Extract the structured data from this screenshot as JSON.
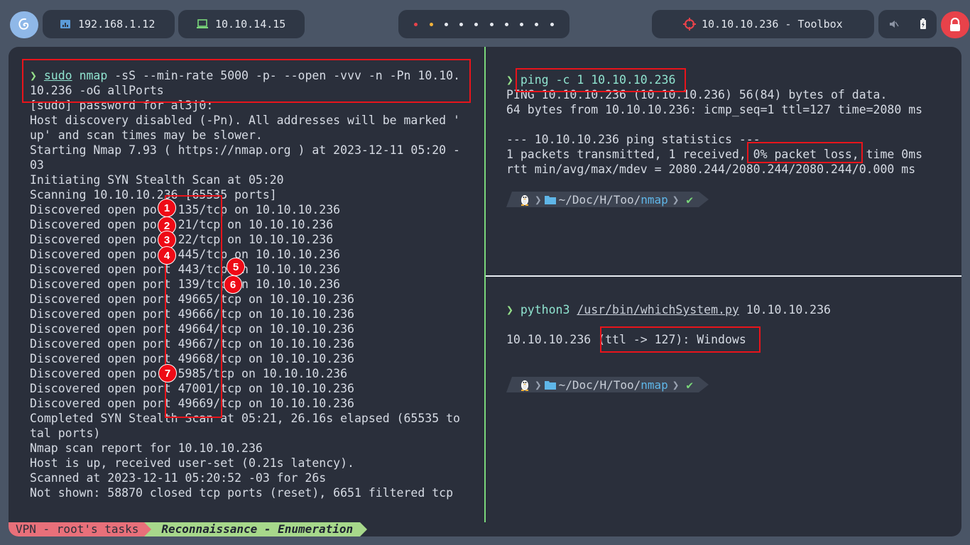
{
  "topbar": {
    "eth_ip": "192.168.1.12",
    "vpn_ip": "10.10.14.15",
    "target": "10.10.10.236 - Toolbox",
    "workspace_count": 10
  },
  "left_pane": {
    "prompt_symbol": "❯",
    "cmd_sudo": "sudo",
    "cmd_nmap": "nmap",
    "cmd_args_1": " -sS --min-rate 5000 -p- --open -vvv -n -Pn 10.10.",
    "cmd_args_2": "10.236 -oG allPorts",
    "lines": [
      "[sudo] password for al3j0:",
      "Host discovery disabled (-Pn). All addresses will be marked '",
      "up' and scan times may be slower.",
      "Starting Nmap 7.93 ( https://nmap.org ) at 2023-12-11 05:20 -",
      "03",
      "Initiating SYN Stealth Scan at 05:20",
      "Scanning 10.10.10.236 [65535 ports]",
      "Discovered open port 135/tcp on 10.10.10.236",
      "Discovered open port 21/tcp on 10.10.10.236",
      "Discovered open port 22/tcp on 10.10.10.236",
      "Discovered open port 445/tcp on 10.10.10.236",
      "Discovered open port 443/tcp on 10.10.10.236",
      "Discovered open port 139/tcp on 10.10.10.236",
      "Discovered open port 49665/tcp on 10.10.10.236",
      "Discovered open port 49666/tcp on 10.10.10.236",
      "Discovered open port 49664/tcp on 10.10.10.236",
      "Discovered open port 49667/tcp on 10.10.10.236",
      "Discovered open port 49668/tcp on 10.10.10.236",
      "Discovered open port 5985/tcp on 10.10.10.236",
      "Discovered open port 47001/tcp on 10.10.10.236",
      "Discovered open port 49669/tcp on 10.10.10.236",
      "Completed SYN Stealth Scan at 05:21, 26.16s elapsed (65535 to",
      "tal ports)",
      "Nmap scan report for 10.10.10.236",
      "Host is up, received user-set (0.21s latency).",
      "Scanned at 2023-12-11 05:20:52 -03 for 26s",
      "Not shown: 58870 closed tcp ports (reset), 6651 filtered tcp"
    ],
    "badges": [
      "1",
      "2",
      "3",
      "4",
      "5",
      "6",
      "7"
    ]
  },
  "right_top": {
    "prompt_symbol": "❯",
    "cmd": "ping -c 1 10.10.10.236",
    "lines": [
      "PING 10.10.10.236 (10.10.10.236) 56(84) bytes of data.",
      "64 bytes from 10.10.10.236: icmp_seq=1 ttl=127 time=2080 ms",
      "",
      "--- 10.10.10.236 ping statistics ---",
      "1 packets transmitted, 1 received, 0% packet loss, time 0ms",
      "rtt min/avg/max/mdev = 2080.244/2080.244/2080.244/0.000 ms"
    ],
    "path_prefix": "~/Doc/H/Too/",
    "path_dir": "nmap",
    "check": "✔"
  },
  "right_bottom": {
    "prompt_symbol": "❯",
    "cmd_python": "python3",
    "cmd_script": "/usr/bin/whichSystem.py",
    "cmd_arg": " 10.10.10.236",
    "result_ip": "10.10.10.236 ",
    "result_info": "(ttl -> 127): Windows",
    "path_prefix": "~/Doc/H/Too/",
    "path_dir": "nmap",
    "check": "✔"
  },
  "statusbar": {
    "session": "VPN - root's tasks",
    "window": "Reconnaissance - Enumeration"
  },
  "colors": {
    "accent_green": "#95e08a",
    "highlight_red": "#e8141b",
    "terminal_bg": "#2a2f3b"
  }
}
